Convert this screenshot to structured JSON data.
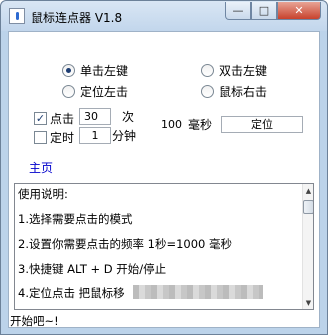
{
  "window": {
    "title": "鼠标连点器 V1.8",
    "buttons": {
      "minimize": "—",
      "maximize": "□",
      "close": "✕"
    }
  },
  "modes": {
    "single_left": "单击左键",
    "double_left": "双击左键",
    "locate_left": "定位左击",
    "mouse_right": "鼠标右击",
    "selected": "single_left"
  },
  "options": {
    "click_label": "点击",
    "click_checked": true,
    "click_count": "30",
    "times_unit": "次",
    "timer_label": "定时",
    "timer_checked": false,
    "timer_value": "1",
    "minutes_unit": "分钟",
    "interval_value": "100",
    "interval_unit": "毫秒",
    "locate_button": "定位"
  },
  "home_link": "主页",
  "instructions": [
    "使用说明:",
    "1.选择需要点击的模式",
    "2.设置你需要点击的频率 1秒=1000 毫秒",
    "3.快捷键 ALT + D 开始/停止",
    "4.定位点击 把鼠标移"
  ],
  "status": "开始吧~!",
  "icons": {
    "scroll_up": "▲",
    "scroll_down": "▼",
    "check": "✓"
  }
}
